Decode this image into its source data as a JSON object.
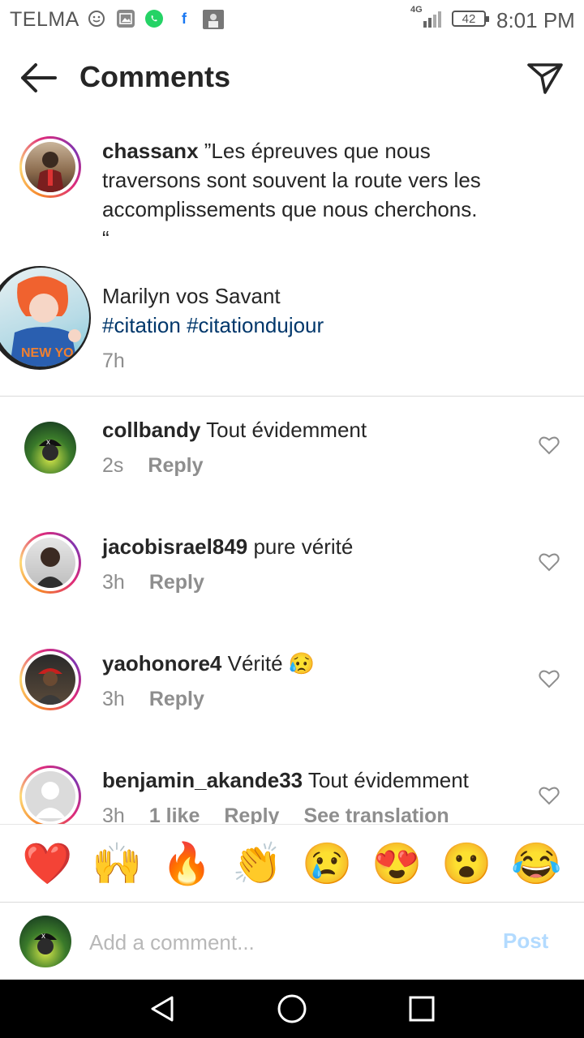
{
  "status_bar": {
    "carrier": "TELMA",
    "network": "4G",
    "battery": "42",
    "time": "8:01 PM",
    "notification_icons": [
      "emoji-icon",
      "gallery-icon",
      "whatsapp-icon",
      "facebook-icon",
      "photo-icon"
    ]
  },
  "header": {
    "title": "Comments",
    "back_icon": "arrow-left-icon",
    "send_icon": "paper-plane-icon"
  },
  "caption": {
    "username": "chassanx",
    "line1": "”Les épreuves que nous",
    "line2": "traversons sont souvent la route vers les",
    "line3": "accomplissements que nous cherchons.",
    "line4": "“",
    "author": "Marilyn vos Savant",
    "hashtags": "#citation #citationdujour",
    "time": "7h"
  },
  "comments": [
    {
      "username": "collbandy",
      "text": "Tout évidemment",
      "time": "2s",
      "likes": "",
      "reply": "Reply",
      "translate": ""
    },
    {
      "username": "jacobisrael849",
      "text": "pure vérité",
      "time": "3h",
      "likes": "",
      "reply": "Reply",
      "translate": ""
    },
    {
      "username": "yaohonore4",
      "text": "Vérité 😥",
      "time": "3h",
      "likes": "",
      "reply": "Reply",
      "translate": ""
    },
    {
      "username": "benjamin_akande33",
      "text": "Tout évidemment",
      "time": "3h",
      "likes": "1 like",
      "reply": "Reply",
      "translate": "See translation"
    }
  ],
  "reactions": [
    "❤️",
    "🙌",
    "🔥",
    "👏",
    "😢",
    "😍",
    "😮",
    "😂"
  ],
  "input": {
    "placeholder": "Add a comment...",
    "post_label": "Post"
  },
  "colors": {
    "hashtag": "#00376b",
    "post_disabled": "#b3dbff",
    "meta": "#8e8e8e"
  }
}
